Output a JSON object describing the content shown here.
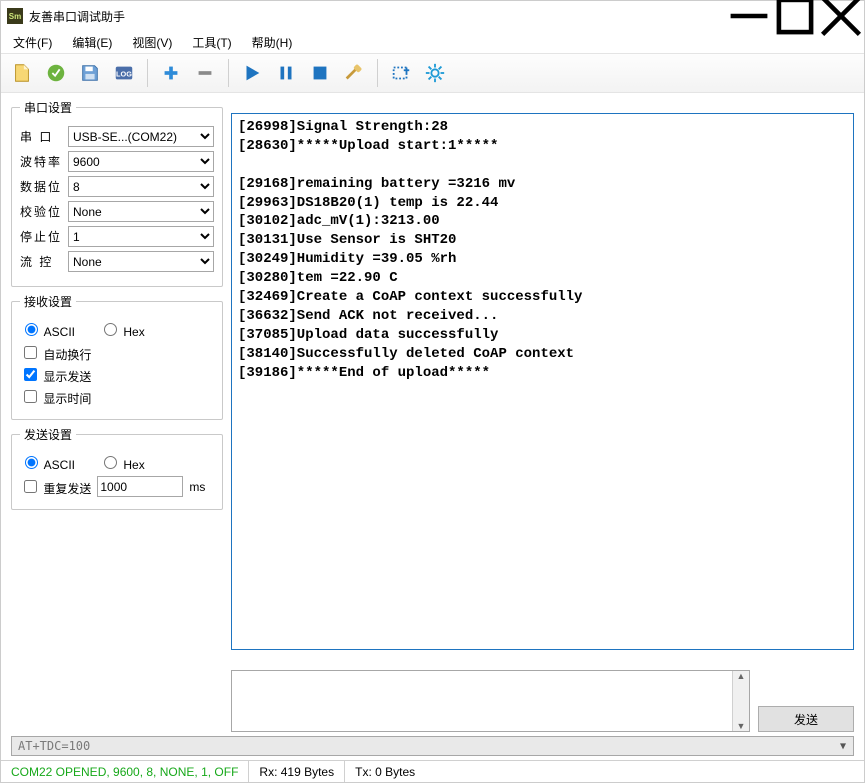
{
  "window": {
    "title": "友善串口调试助手",
    "app_icon_text": "Sm"
  },
  "menu": {
    "file": "文件(F)",
    "edit": "编辑(E)",
    "view": "视图(V)",
    "tools": "工具(T)",
    "help": "帮助(H)"
  },
  "serial_settings": {
    "legend": "串口设置",
    "port_label": "串 口",
    "port_value": "USB-SE...(COM22)",
    "baud_label": "波特率",
    "baud_value": "9600",
    "databits_label": "数据位",
    "databits_value": "8",
    "parity_label": "校验位",
    "parity_value": "None",
    "stopbits_label": "停止位",
    "stopbits_value": "1",
    "flow_label": "流 控",
    "flow_value": "None"
  },
  "recv_settings": {
    "legend": "接收设置",
    "mode_ascii": "ASCII",
    "mode_hex": "Hex",
    "auto_wrap": "自动换行",
    "show_send": "显示发送",
    "show_time": "显示时间"
  },
  "send_settings": {
    "legend": "发送设置",
    "mode_ascii": "ASCII",
    "mode_hex": "Hex",
    "repeat_label": "重复发送",
    "repeat_value": 1000,
    "repeat_unit": "ms"
  },
  "output_lines": "[26998]Signal Strength:28\n[28630]*****Upload start:1*****\n\n[29168]remaining battery =3216 mv\n[29963]DS18B20(1) temp is 22.44\n[30102]adc_mV(1):3213.00\n[30131]Use Sensor is SHT20\n[30249]Humidity =39.05 %rh\n[30280]tem =22.90 C\n[32469]Create a CoAP context successfully\n[36632]Send ACK not received...\n[37085]Upload data successfully\n[38140]Successfully deleted CoAP context\n[39186]*****End of upload*****",
  "send": {
    "button": "发送",
    "input_value": ""
  },
  "graybar_text": "AT+TDC=100",
  "status": {
    "conn": "COM22 OPENED, 9600, 8, NONE, 1, OFF",
    "rx": "Rx: 419 Bytes",
    "tx": "Tx: 0 Bytes"
  }
}
